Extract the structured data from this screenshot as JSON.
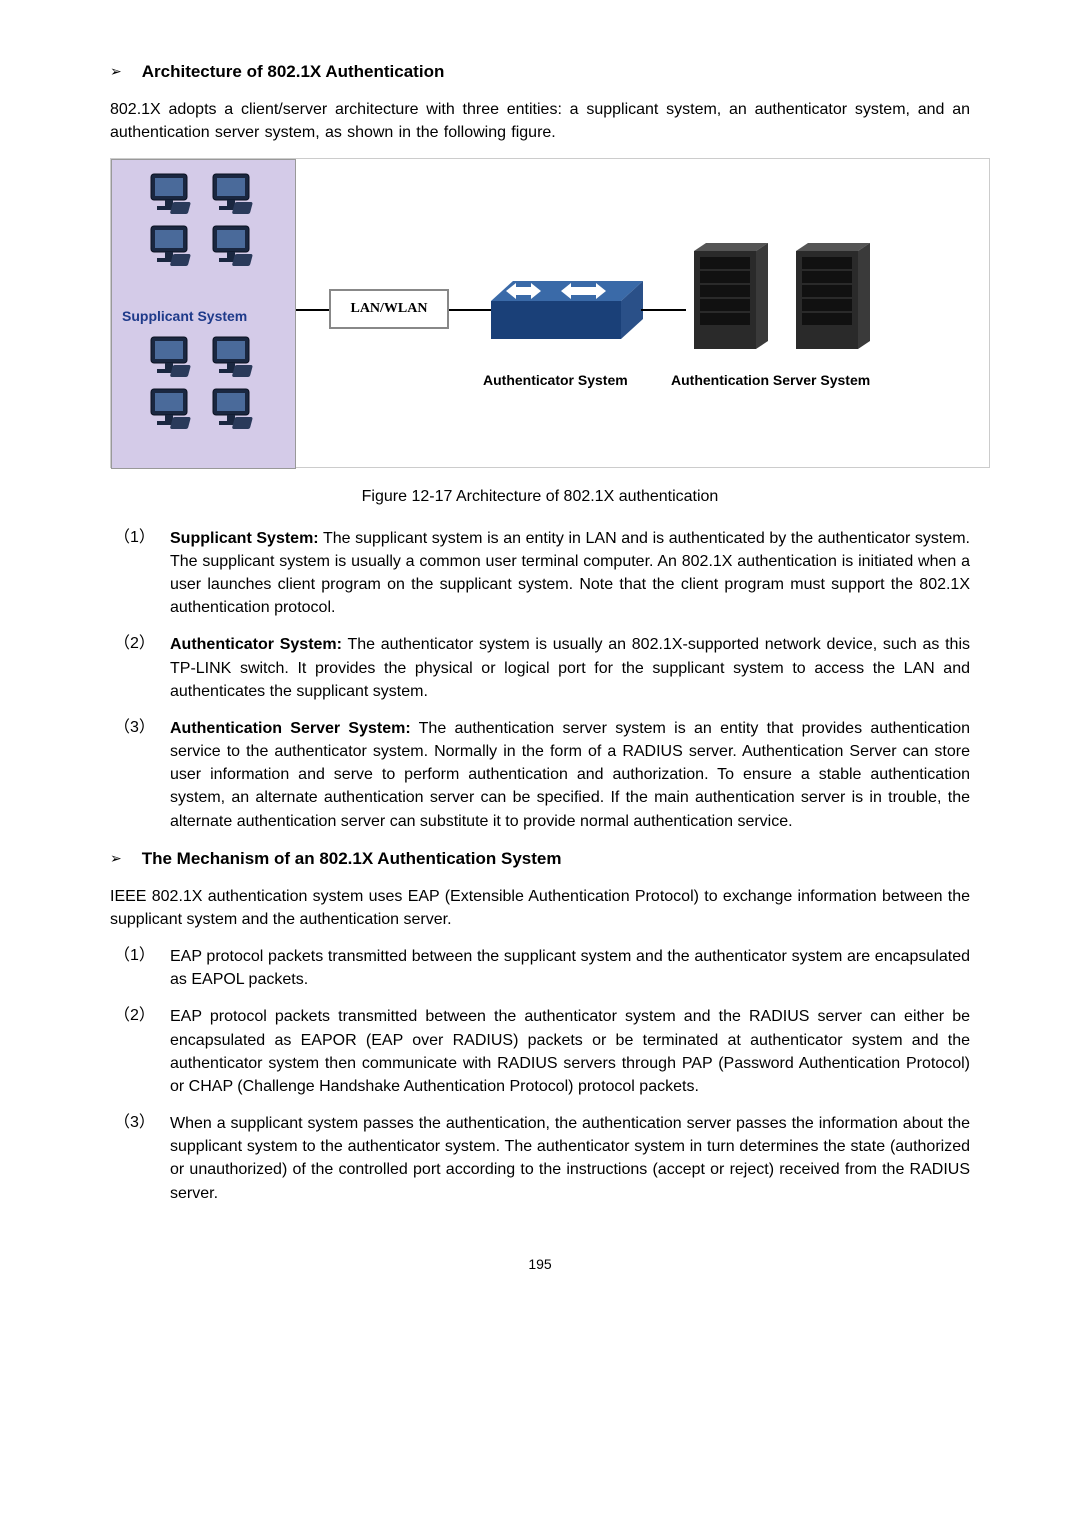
{
  "section1": {
    "heading": "Architecture of 802.1X Authentication",
    "intro": "802.1X adopts a client/server architecture with three entities: a supplicant system, an authenticator system, and an authentication server system, as shown in the following figure."
  },
  "diagram": {
    "supplicant_label": "Supplicant System",
    "lan_label": "LAN/WLAN",
    "auth_system_label": "Authenticator System",
    "auth_server_label": "Authentication Server System"
  },
  "figure_caption": "Figure 12-17 Architecture of 802.1X authentication",
  "definitions": [
    {
      "num": "（1）",
      "term": "Supplicant System:",
      "text": " The supplicant system is an entity in LAN and is authenticated by the authenticator system. The supplicant system is usually a common user terminal computer. An 802.1X authentication is initiated when a user launches client program on the supplicant system. Note that the client program must support the 802.1X authentication protocol."
    },
    {
      "num": "（2）",
      "term": "Authenticator System:",
      "text": " The authenticator system is usually an 802.1X-supported network device, such as this TP-LINK switch. It provides the physical or logical port for the supplicant system to access the LAN and authenticates the supplicant system."
    },
    {
      "num": "（3）",
      "term": "Authentication Server System:",
      "text": " The authentication server system is an entity that provides authentication service to the authenticator system. Normally in the form of a RADIUS server. Authentication Server can store user information and serve to perform authentication and authorization. To ensure a stable authentication system, an alternate authentication server can be specified. If the main authentication server is in trouble, the alternate authentication server can substitute it to provide normal authentication service."
    }
  ],
  "section2": {
    "heading": "The Mechanism of an 802.1X Authentication System",
    "intro": "IEEE 802.1X authentication system uses EAP (Extensible Authentication Protocol) to exchange information between the supplicant system and the authentication server."
  },
  "mechanism": [
    {
      "num": "（1）",
      "text": "EAP protocol packets transmitted between the supplicant system and the authenticator system are encapsulated as EAPOL packets."
    },
    {
      "num": "（2）",
      "text": "EAP protocol packets transmitted between the authenticator system and the RADIUS server can either be encapsulated as EAPOR (EAP over RADIUS) packets or be terminated at authenticator system and the authenticator system then communicate with RADIUS servers through PAP (Password Authentication Protocol) or CHAP (Challenge Handshake Authentication Protocol) protocol packets."
    },
    {
      "num": "（3）",
      "text": "When a supplicant system passes the authentication, the authentication server passes the information about the supplicant system to the authenticator system. The authenticator system in turn determines the state (authorized or unauthorized) of the controlled port according to the instructions (accept or reject) received from the RADIUS server."
    }
  ],
  "page_number": "195"
}
